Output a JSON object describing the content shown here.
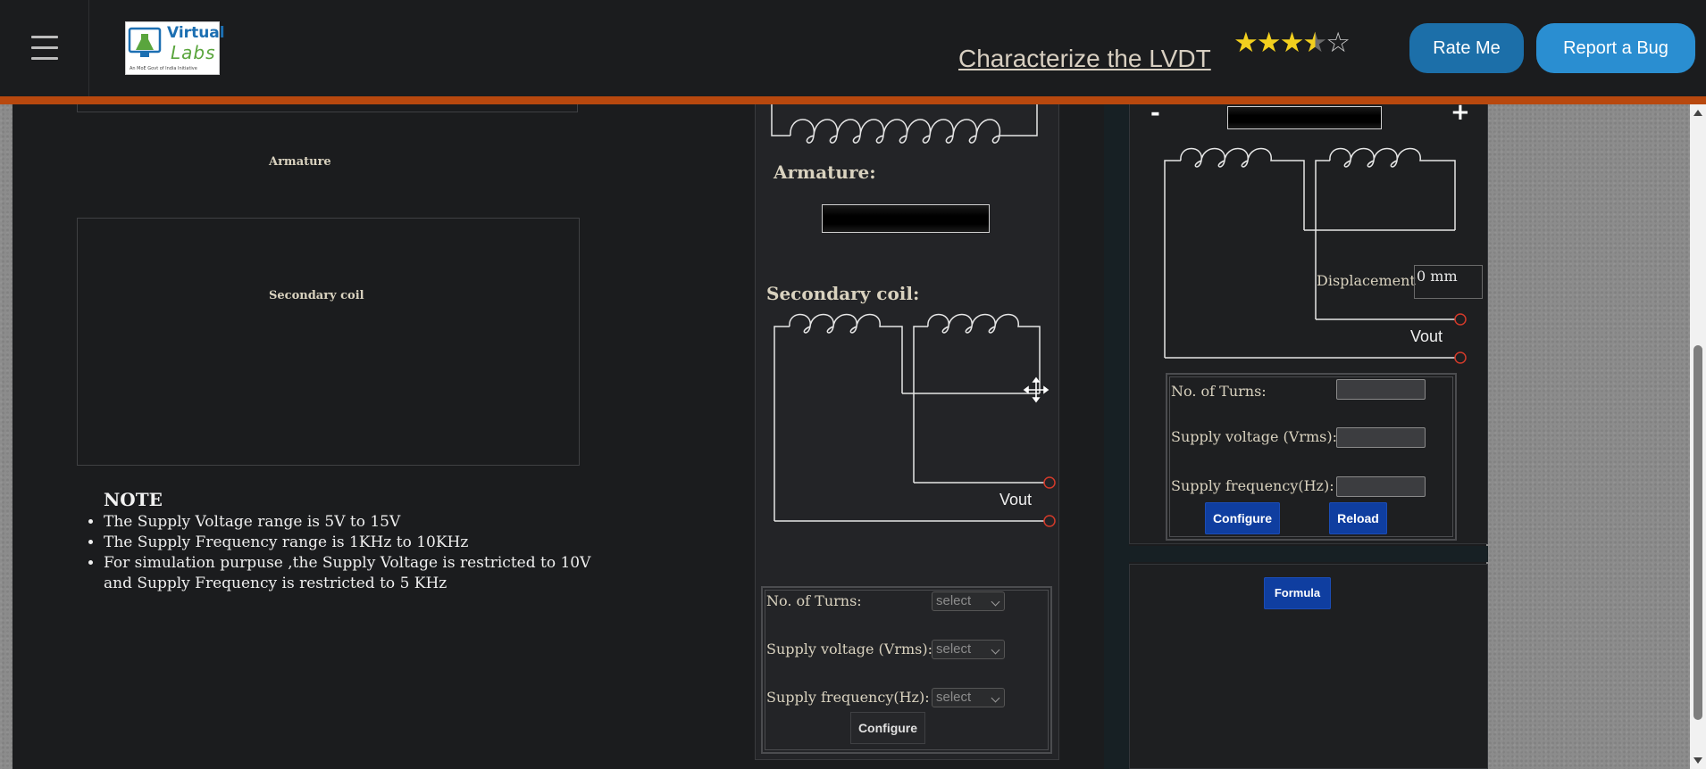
{
  "header": {
    "logo": {
      "line1": "Virtual",
      "line2": "Labs",
      "tagline": "An MoE Govt of India Initiative"
    },
    "title": "Characterize the LVDT",
    "rating": {
      "stars": [
        "★",
        "★",
        "★",
        "★",
        "☆"
      ],
      "value": 3.5,
      "max": 5
    },
    "rate_button": "Rate Me",
    "bug_button": "Report a Bug"
  },
  "left": {
    "armature_label": "Armature",
    "secondary_label": "Secondary coil",
    "note_title": "NOTE",
    "notes": [
      "The Supply Voltage range is 5V to 15V",
      "The Supply Frequency range is 1KHz to 10KHz",
      "For simulation purpuse ,the Supply Voltage is restricted to 10V and Supply Frequency is restricted to 5 KHz"
    ]
  },
  "middle": {
    "armature_heading": "Armature:",
    "secondary_heading": "Secondary coil:",
    "vout": "Vout",
    "form": {
      "turns_label": "No. of Turns:",
      "voltage_label": "Supply voltage (Vrms):",
      "frequency_label": "Supply frequency(Hz):",
      "select_value": "select",
      "configure": "Configure"
    }
  },
  "right": {
    "minus": "-",
    "plus": "+",
    "displacement_label": "Displacement",
    "displacement_value": "0 mm",
    "vout": "Vout",
    "form": {
      "turns_label": "No. of Turns:",
      "voltage_label": "Supply voltage (Vrms):",
      "frequency_label": "Supply frequency(Hz):",
      "configure": "Configure",
      "reload": "Reload"
    },
    "formula_button": "Formula"
  },
  "colors": {
    "accent_bar": "#b8480e",
    "rate_btn": "#1c6fa9",
    "bug_btn": "#2a8ed1",
    "action_btn": "#0f3ea0"
  }
}
